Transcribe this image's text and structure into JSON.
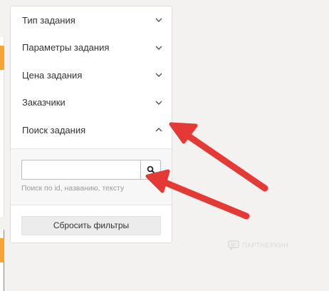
{
  "filters": {
    "sections": [
      {
        "label": "Тип задания",
        "state": "collapsed"
      },
      {
        "label": "Параметры задания",
        "state": "collapsed"
      },
      {
        "label": "Цена задания",
        "state": "collapsed"
      },
      {
        "label": "Заказчики",
        "state": "collapsed"
      },
      {
        "label": "Поиск задания",
        "state": "expanded"
      }
    ],
    "search": {
      "value": "",
      "placeholder": "",
      "button_icon": "search-icon",
      "hint": "Поиск по id, названию, тексту"
    },
    "reset_label": "Сбросить фильтры"
  },
  "watermark": {
    "icon": "chat-bubble-icon",
    "text": "ПАРТНЕРКИН"
  },
  "colors": {
    "annotation_arrow": "#e53935",
    "accent_orange": "#f6a33a",
    "accent_blue": "#2aa8d8"
  }
}
